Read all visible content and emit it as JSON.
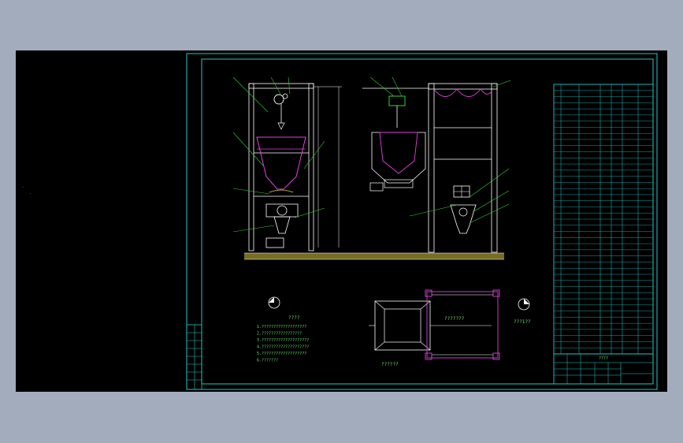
{
  "drawing": {
    "background_color": "#000000",
    "outside_color": "#a3acbc",
    "border_color": "#1fc9c9",
    "frame_color": "#ffffff",
    "hoist_color": "#e040e0",
    "leader_color": "#33d233",
    "base_color": "#d8c840"
  },
  "notes": {
    "heading": "????",
    "lines": [
      "1.???????????????????",
      "2.?????????????????",
      "3.????????????????????",
      "4.????????????????????",
      "5.???????????????????",
      "6.???????"
    ]
  },
  "views": {
    "plan_view_label": "??????",
    "detail_label": "???????",
    "symbol_label": "???1??"
  },
  "title_block": {
    "name": "????"
  }
}
